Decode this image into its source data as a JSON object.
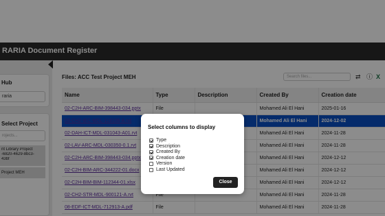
{
  "app": {
    "title": "RARIA Document Register"
  },
  "sidebar": {
    "hub": {
      "title": "Hub",
      "value": "raria"
    },
    "project": {
      "title": "Select Project",
      "search_placeholder": "rojects...",
      "items": [
        {
          "lines": [
            "nt Library Project",
            "-6820-4629-8bc3-",
            "43bf"
          ]
        },
        {
          "lines": [
            "Project MEH"
          ]
        }
      ]
    }
  },
  "files": {
    "title": "Files: ACC Test Project MEH",
    "search_placeholder": "Search files...",
    "toolbar_icons": [
      "swap-arrows-icon",
      "info-icon",
      "excel-icon"
    ]
  },
  "table": {
    "columns": [
      "Name",
      "Type",
      "Description",
      "Created By",
      "Creation date"
    ],
    "rows": [
      {
        "name": "02-C2H-ARC-BIM-398443-034.pptx",
        "type": "File",
        "description": "",
        "created_by": "Mohamed Ali El Hani",
        "date": "2025-01-16",
        "selected": false
      },
      {
        "name": "03-CH2-IEC-MDL-119106-A.rvt",
        "type": "File",
        "description": "",
        "created_by": "Mohamed Ali El Hani",
        "date": "2024-12-02",
        "selected": true
      },
      {
        "name": "02-DAH-ICT-MDL-031043-A01.rvt",
        "type": "File",
        "description": "",
        "created_by": "Mohamed Ali El Hani",
        "date": "2024-11-28",
        "selected": false
      },
      {
        "name": "02-LAV-ARC-MDL-030350-0.1.rvt",
        "type": "File",
        "description": "",
        "created_by": "Mohamed Ali El Hani",
        "date": "2024-11-28",
        "selected": false
      },
      {
        "name": "02-C2H-ARC-BIM-398443-034.pptx",
        "type": "File",
        "description": "",
        "created_by": "Mohamed Ali El Hani",
        "date": "2024-12-12",
        "selected": false
      },
      {
        "name": "02-C2H-BIM-ARC-344222-01.docx",
        "type": "File",
        "description": "",
        "created_by": "Mohamed Ali El Hani",
        "date": "2024-12-12",
        "selected": false
      },
      {
        "name": "02-C2H-BIM-BIM-112344-01.xlsx",
        "type": "File",
        "description": "",
        "created_by": "Mohamed Ali El Hani",
        "date": "2024-12-12",
        "selected": false
      },
      {
        "name": "02-CH2-STR-MDL-900121-A.rvt",
        "type": "File",
        "description": "",
        "created_by": "Mohamed Ali El Hani",
        "date": "2024-11-28",
        "selected": false
      },
      {
        "name": "08-EDF-ICT-MDL-712913-A.pdf",
        "type": "File",
        "description": "",
        "created_by": "Mohamed Ali El Hani",
        "date": "2024-11-28",
        "selected": false
      }
    ]
  },
  "modal": {
    "title": "Select columns to display",
    "options": [
      {
        "label": "Type",
        "checked": true
      },
      {
        "label": "Description",
        "checked": true
      },
      {
        "label": "Created By",
        "checked": true
      },
      {
        "label": "Creation date",
        "checked": true
      },
      {
        "label": "Version",
        "checked": false
      },
      {
        "label": "Last Updated",
        "checked": false
      }
    ],
    "close_label": "Close"
  }
}
